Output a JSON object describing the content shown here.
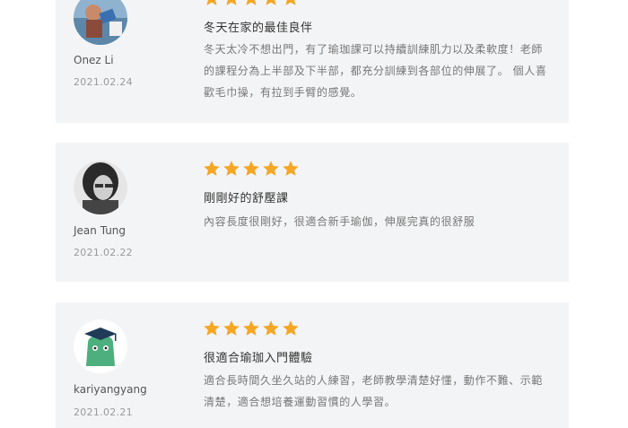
{
  "reviews": [
    {
      "name": "Onez Li",
      "date": "2021.02.24",
      "rating": 5,
      "title": "冬天在家的最佳良伴",
      "body": "冬天太冷不想出門，有了瑜珈課可以持續訓練肌力以及柔軟度！老師的課程分為上半部及下半部，都充分訓練到各部位的伸展了。 個人喜歡毛巾操，有拉到手臂的感覺。"
    },
    {
      "name": "Jean Tung",
      "date": "2021.02.22",
      "rating": 5,
      "title": "剛剛好的舒壓課",
      "body": "內容長度很剛好，很適合新手瑜伽，伸展完真的很舒服"
    },
    {
      "name": "kariyangyang",
      "date": "2021.02.21",
      "rating": 5,
      "title": "很適合瑜珈入門體驗",
      "body": "適合長時間久坐久站的人練習，老師教學清楚好懂，動作不難、示範清楚，適合想培養運動習慣的人學習。"
    }
  ],
  "colors": {
    "card_bg": "#f3f4f6",
    "star": "#f5a623",
    "avatar3_bg": "#4caf7d"
  },
  "icons": {
    "star": "star-icon"
  }
}
